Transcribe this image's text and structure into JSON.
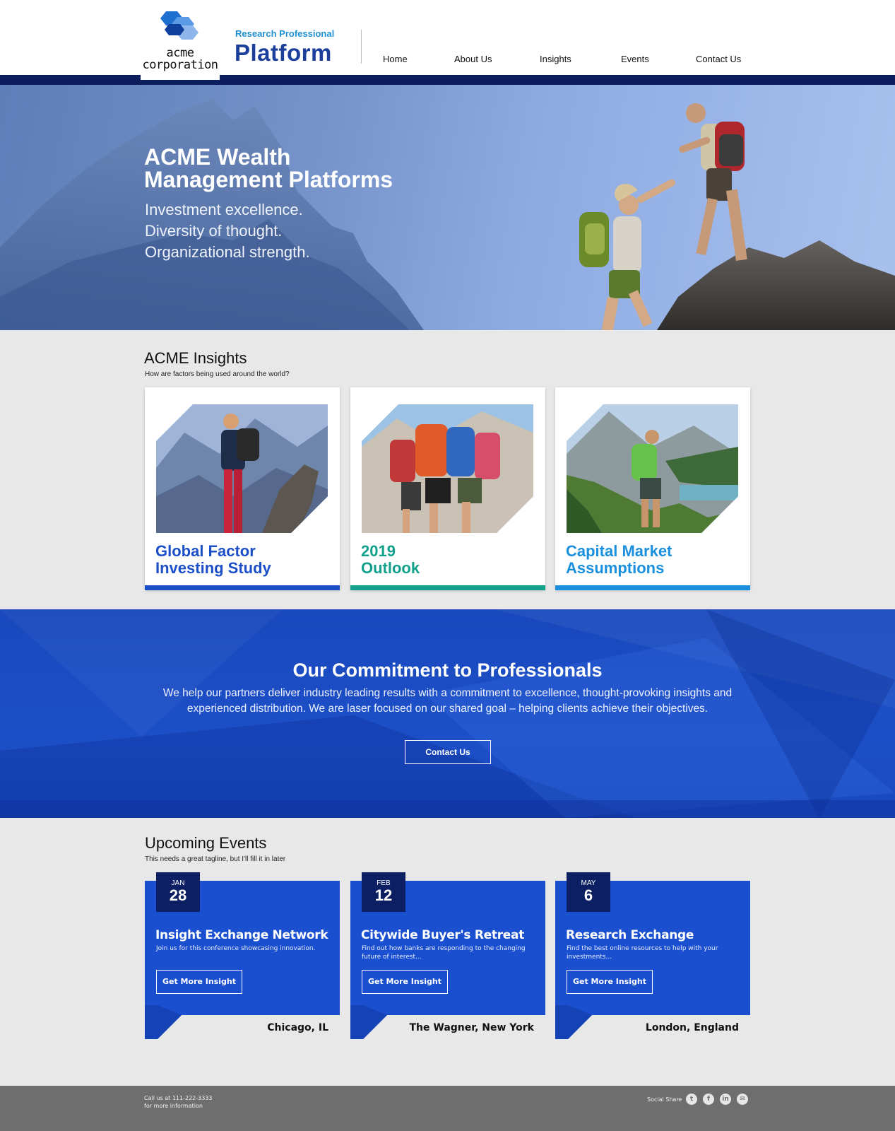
{
  "header": {
    "logo_line1": "acme",
    "logo_line2": "corporation",
    "tagline_small": "Research Professional",
    "tagline_big": "Platform",
    "nav": [
      "Home",
      "About Us",
      "Insights",
      "Events",
      "Contact Us"
    ]
  },
  "hero": {
    "title_line1": "ACME Wealth",
    "title_line2": "Management Platforms",
    "sub_line1": "Investment excellence.",
    "sub_line2": "Diversity of thought.",
    "sub_line3": "Organizational strength."
  },
  "insights": {
    "title": "ACME Insights",
    "subtitle": "How are factors being used around the world?",
    "cards": [
      {
        "line1": "Global Factor",
        "line2": "Investing Study",
        "color": "#1c4fc7",
        "bar": "#1c4fc7"
      },
      {
        "line1": "2019",
        "line2": "Outlook",
        "color": "#13a08a",
        "bar": "#13a08a"
      },
      {
        "line1": "Capital Market",
        "line2": "Assumptions",
        "color": "#1a8fdd",
        "bar": "#1a8fdd"
      }
    ]
  },
  "commitment": {
    "title": "Our Commitment to Professionals",
    "text": "We help our partners deliver industry leading results with a commitment to excellence, thought-provoking insights and experienced distribution. We are laser focused on our shared goal – helping clients achieve their objectives.",
    "button": "Contact Us"
  },
  "events": {
    "title": "Upcoming Events",
    "subtitle": "This needs a great tagline, but I'll fill it in later",
    "items": [
      {
        "month": "JAN",
        "day": "28",
        "title": "Insight Exchange Network",
        "desc": "Join us for this conference showcasing innovation.",
        "button": "Get More Insight",
        "location": "Chicago, IL"
      },
      {
        "month": "FEB",
        "day": "12",
        "title": "Citywide Buyer's Retreat",
        "desc": "Find out how banks are responding to the changing future of interest...",
        "button": "Get More Insight",
        "location": "The Wagner, New York"
      },
      {
        "month": "MAY",
        "day": "6",
        "title": "Research Exchange",
        "desc": "Find the best online resources to help with your investments...",
        "button": "Get More Insight",
        "location": "London, England"
      }
    ]
  },
  "footer": {
    "call_line1": "Call us at 111-222-3333",
    "call_line2": "for more information",
    "share_label": "Social Share",
    "social_icons": [
      "twitter-icon",
      "facebook-icon",
      "linkedin-icon",
      "email-icon"
    ]
  },
  "colors": {
    "brand_navy": "#0c1d5e",
    "brand_blue": "#1c4fc7",
    "accent_cyan": "#1f8fd1",
    "teal": "#13a08a"
  }
}
